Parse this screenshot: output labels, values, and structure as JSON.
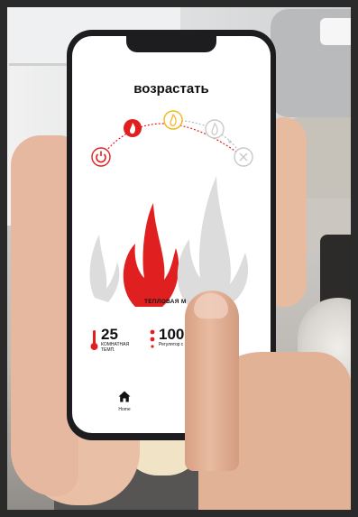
{
  "screen": {
    "title": "возрастать",
    "mode_label": "ТЕПЛОВАЯ М",
    "stats": [
      {
        "value": "25",
        "label_lines": [
          "КОМНАТНАЯ",
          "ТЕМП."
        ],
        "icon": "thermometer-icon"
      },
      {
        "value": "100",
        "label_lines": [
          "Регулятор с"
        ],
        "icon": "level-dots-icon"
      }
    ],
    "nav": {
      "home_label": "Home",
      "icon": "home-icon"
    },
    "stepper": {
      "steps": [
        {
          "icon": "power-icon",
          "state": "active"
        },
        {
          "icon": "flame-icon",
          "state": "active"
        },
        {
          "icon": "flame-up-icon",
          "state": "current"
        },
        {
          "icon": "flame-icon",
          "state": "inactive"
        },
        {
          "icon": "cross-icon",
          "state": "inactive"
        }
      ]
    },
    "flame_level": "medium"
  },
  "colors": {
    "accent_red": "#e02020",
    "current_yellow": "#f2b619",
    "inactive_gray": "#c9c9c9",
    "flame_gray": "#dcdcdc"
  }
}
